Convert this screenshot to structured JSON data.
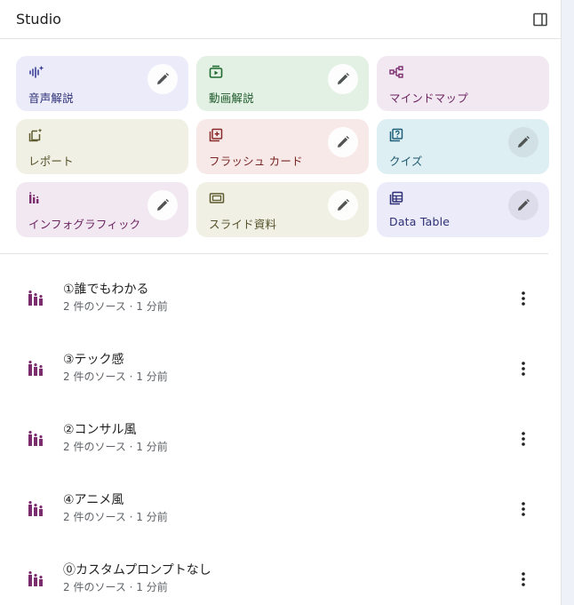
{
  "header": {
    "title": "Studio"
  },
  "colors": {
    "purple_card": "#ecebfa",
    "green_card": "#e3f1e4",
    "mauve_card": "#f2e8f2",
    "olive_card": "#f1f0e5",
    "rose_card": "#f8e9e9",
    "blue_card": "#deeff4",
    "infographic_accent": "#7b2d6e"
  },
  "cards": [
    {
      "label": "音声解説",
      "icon": "audio-waveform-icon",
      "editable": true
    },
    {
      "label": "動画解説",
      "icon": "video-play-icon",
      "editable": true
    },
    {
      "label": "マインドマップ",
      "icon": "mind-map-icon",
      "editable": false
    },
    {
      "label": "レポート",
      "icon": "report-icon",
      "editable": false
    },
    {
      "label": "フラッシュ カード",
      "icon": "flashcards-icon",
      "editable": true
    },
    {
      "label": "クイズ",
      "icon": "quiz-icon",
      "editable": true
    },
    {
      "label": "インフォグラフィック",
      "icon": "infographic-icon",
      "editable": true
    },
    {
      "label": "スライド資料",
      "icon": "slides-icon",
      "editable": true
    },
    {
      "label": "Data Table",
      "icon": "table-icon",
      "editable": true
    }
  ],
  "outputs": [
    {
      "title": "①誰でもわかる",
      "meta": "2 件のソース · 1 分前"
    },
    {
      "title": "③テック感",
      "meta": "2 件のソース · 1 分前"
    },
    {
      "title": "②コンサル風",
      "meta": "2 件のソース · 1 分前"
    },
    {
      "title": "④アニメ風",
      "meta": "2 件のソース · 1 分前"
    },
    {
      "title": "⓪カスタムプロンプトなし",
      "meta": "2 件のソース · 1 分前"
    }
  ]
}
